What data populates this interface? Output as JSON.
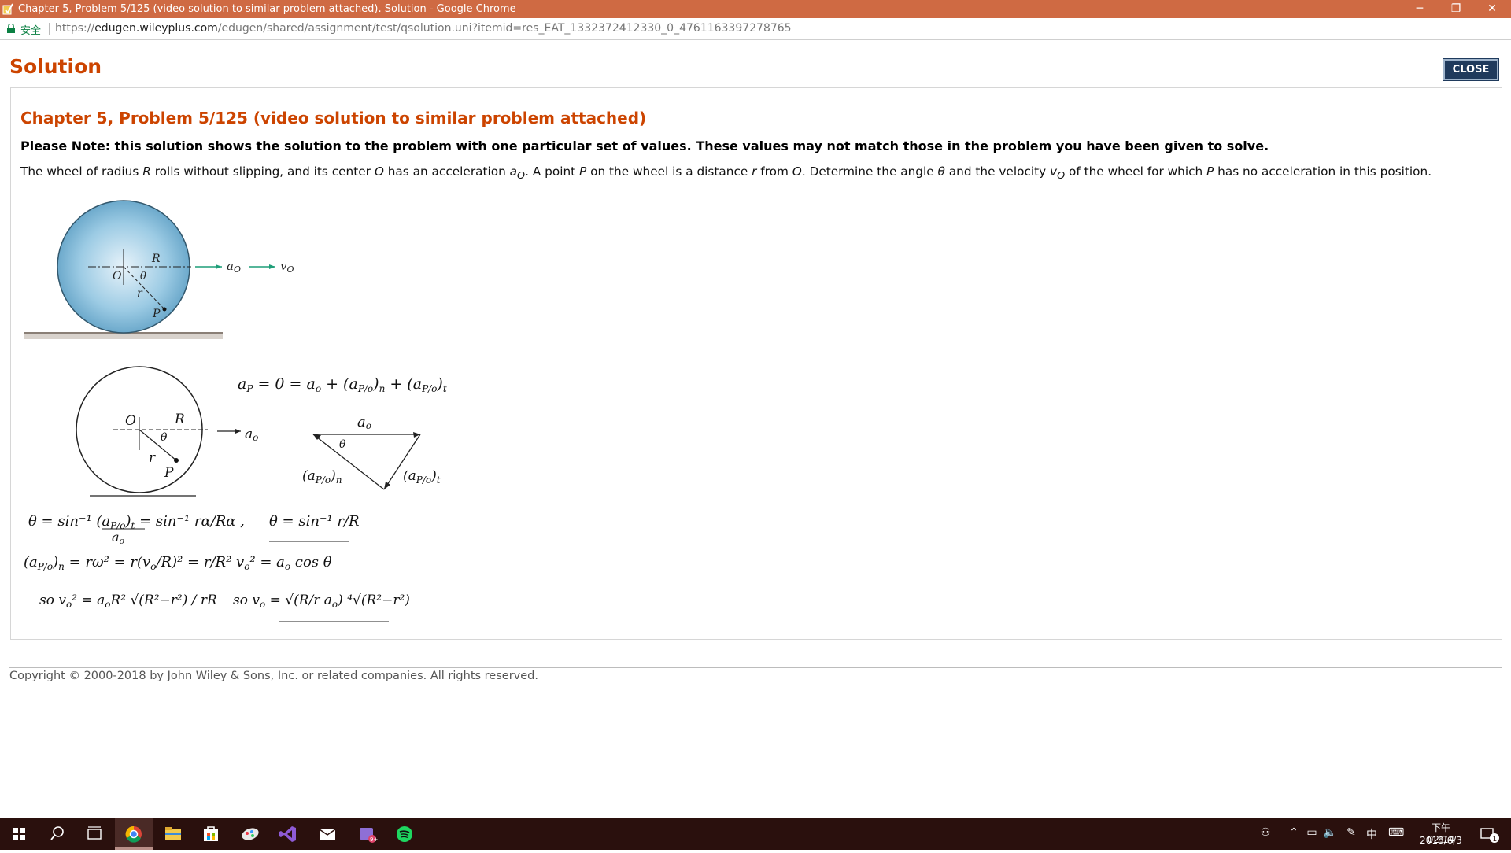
{
  "browser": {
    "window_title": "Chapter 5, Problem 5/125 (video solution to similar problem attached). Solution - Google Chrome",
    "security_label": "安全",
    "url_scheme": "https://",
    "url_host": "edugen.wileyplus.com",
    "url_path": "/edugen/shared/assignment/test/qsolution.uni?itemid=res_EAT_1332372412330_0_4761163397278765",
    "controls": {
      "minimize": "─",
      "restore": "❐",
      "close": "✕"
    }
  },
  "page": {
    "title": "Solution",
    "close_button": "CLOSE",
    "problem_heading": "Chapter 5, Problem 5/125 (video solution to similar problem attached)",
    "note": "Please Note: this solution shows the solution to the problem with one particular set of values. These values may not match those in the problem you have been given to solve.",
    "statement": {
      "s1": "The wheel of radius ",
      "R": "R",
      "s2": " rolls without slipping, and its center ",
      "O": "O",
      "s3": " has an acceleration ",
      "a": "a",
      "a_sub": "O",
      "s4": ". A point ",
      "P": "P",
      "s5": " on the wheel is a distance ",
      "r": "r",
      "s6": " from ",
      "O2": "O",
      "s7": ". Determine the angle ",
      "theta": "θ",
      "s8": " and the velocity ",
      "v": "v",
      "v_sub": "O",
      "s9": " of the wheel for which ",
      "P2": "P",
      "s10": " has no acceleration in this position."
    },
    "figure": {
      "label_R": "R",
      "label_O": "O",
      "label_theta": "θ",
      "label_r": "r",
      "label_P": "P",
      "label_a": "a",
      "label_a_sub": "O",
      "label_v": "v",
      "label_v_sub": "O"
    },
    "handwork": {
      "eq1": "a_P = 0 = a_O + (a_P/O)_n + (a_P/O)_t",
      "eq2": "θ = sin⁻¹ (a_P/O)_t / a_O = sin⁻¹ rα / Rα ,  θ = sin⁻¹ r / R",
      "eq3": "(a_P/O)_n = rω² = r(v_O/R)² = r/R² v_O² = a_O cos θ",
      "eq4": "so  v_O² = a_O R² √(R²−r²) / (r R)   so  v_O = √(R/r a_O) ⁴√(R²−r²)"
    },
    "copyright": "Copyright © 2000-2018 by John Wiley & Sons, Inc. or related companies. All rights reserved."
  },
  "taskbar": {
    "apps": [
      "start-icon",
      "search-icon",
      "task-view-icon",
      "chrome-icon",
      "file-explorer-icon",
      "store-icon",
      "paint3d-icon",
      "visual-studio-icon",
      "mail-icon",
      "media-icon",
      "spotify-icon"
    ],
    "tray": {
      "people": "⚇",
      "chevron": "⌃",
      "network": "▭",
      "volume": "🔈",
      "pen": "✎",
      "ime": "中",
      "keyboard": "⌨"
    },
    "time": "下午 02:14",
    "date": "2018/6/3",
    "notification_count": "1"
  },
  "colors": {
    "titlebar": "#cf6a43",
    "heading": "#cc4400",
    "taskbar": "#2a100d",
    "close_button": "#1f3a5c"
  }
}
